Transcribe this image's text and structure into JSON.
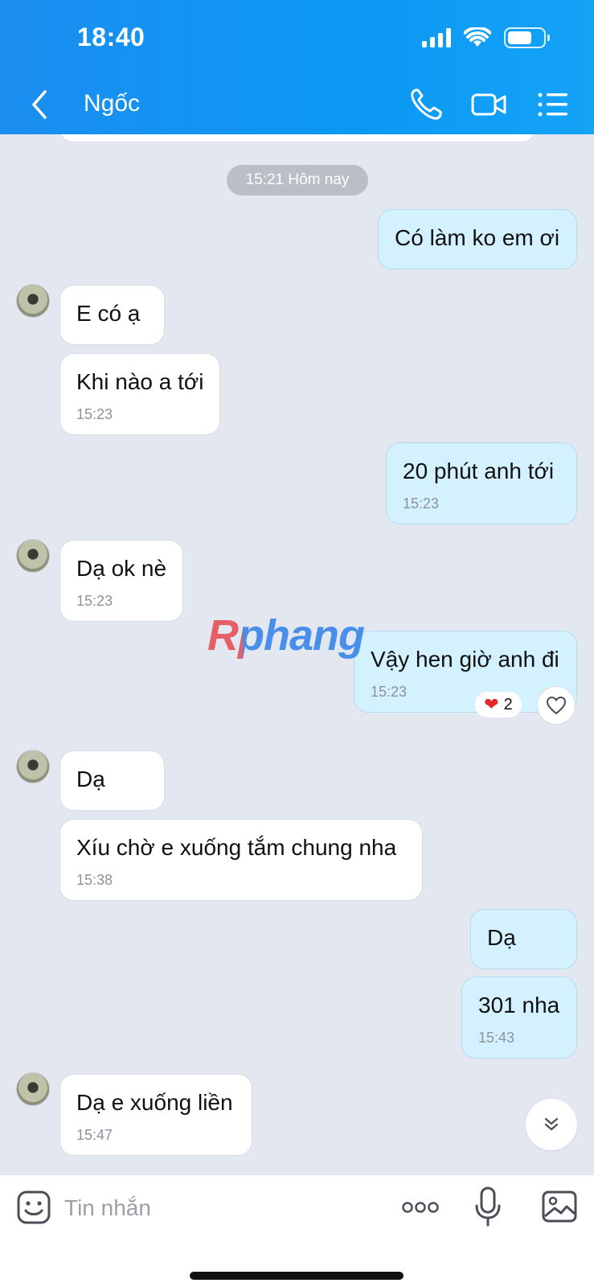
{
  "status_bar": {
    "time": "18:40",
    "battery_level": 0.7
  },
  "header": {
    "contact_name": "Ngốc"
  },
  "chat": {
    "date_separator": "15:21 Hôm nay",
    "messages": [
      {
        "dir": "out",
        "text": "Có làm ko em ơi",
        "time": ""
      },
      {
        "dir": "in",
        "text": "E có ạ",
        "time": ""
      },
      {
        "dir": "in",
        "text": "Khi nào a tới",
        "time": "15:23"
      },
      {
        "dir": "out",
        "text": "20 phút anh tới",
        "time": "15:23"
      },
      {
        "dir": "in",
        "text": "Dạ ok nè",
        "time": "15:23"
      },
      {
        "dir": "out",
        "text": "Vậy hen giờ anh đi",
        "time": "15:23"
      },
      {
        "dir": "in",
        "text": "Dạ",
        "time": ""
      },
      {
        "dir": "in",
        "text": "Xíu chờ e xuống tắm chung nha",
        "time": "15:38"
      },
      {
        "dir": "out",
        "text": "Dạ",
        "time": ""
      },
      {
        "dir": "out",
        "text": "301 nha",
        "time": "15:43"
      },
      {
        "dir": "in",
        "text": "Dạ e xuống liền",
        "time": "15:47"
      }
    ],
    "reaction": {
      "icon": "heart-icon",
      "count": "2"
    },
    "watermark": "Rphang"
  },
  "input": {
    "placeholder": "Tin nhắn"
  },
  "colors": {
    "header": "#0b98f5",
    "outgoing_bubble": "#d4f1ff",
    "incoming_bubble": "#ffffff",
    "chat_bg": "#e2e7f0"
  }
}
